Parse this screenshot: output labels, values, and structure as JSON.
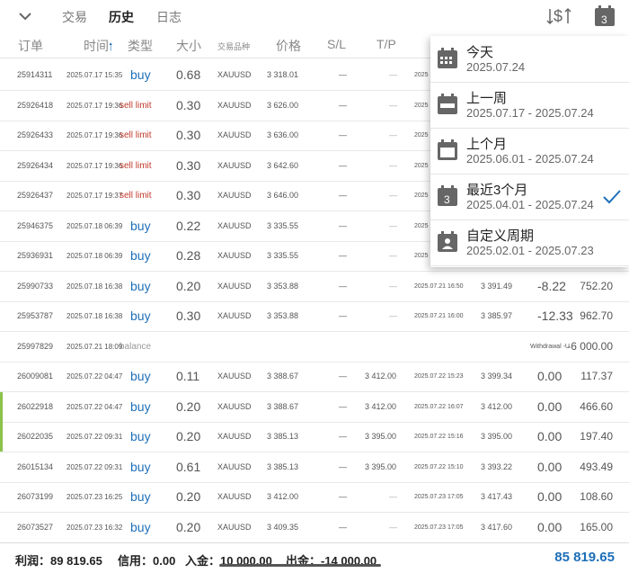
{
  "tabs": [
    "交易",
    "历史",
    "日志"
  ],
  "top_icons": {
    "dollar": "dollar-sort-icon",
    "calendar_day": "3"
  },
  "columns": {
    "ticket": "订单",
    "time": "时间",
    "type": "类型",
    "volume": "大小",
    "symbol": "交易品种",
    "price": "价格",
    "sl": "S/L",
    "tp": "T/P"
  },
  "rows": [
    {
      "id": "25914311",
      "time": "2025.07.17 15:35",
      "type": "buy",
      "volume": "0.68",
      "symbol": "XAUUSD",
      "price": "3 318.01",
      "sl": "—",
      "tp": "—",
      "close_time": "2025",
      "close_price": "",
      "swap": "",
      "profit": "",
      "comment": ""
    },
    {
      "id": "25926418",
      "time": "2025.07.17 19:36",
      "type": "sell limit",
      "volume": "0.30",
      "symbol": "XAUUSD",
      "price": "3 626.00",
      "sl": "—",
      "tp": "—",
      "close_time": "2025",
      "close_price": "",
      "swap": "",
      "profit": "",
      "comment": ""
    },
    {
      "id": "25926433",
      "time": "2025.07.17 19:36",
      "type": "sell limit",
      "volume": "0.30",
      "symbol": "XAUUSD",
      "price": "3 636.00",
      "sl": "—",
      "tp": "—",
      "close_time": "2025",
      "close_price": "",
      "swap": "",
      "profit": "",
      "comment": ""
    },
    {
      "id": "25926434",
      "time": "2025.07.17 19:36",
      "type": "sell limit",
      "volume": "0.30",
      "symbol": "XAUUSD",
      "price": "3 642.60",
      "sl": "—",
      "tp": "—",
      "close_time": "2025",
      "close_price": "",
      "swap": "",
      "profit": "",
      "comment": ""
    },
    {
      "id": "25926437",
      "time": "2025.07.17 19:37",
      "type": "sell limit",
      "volume": "0.30",
      "symbol": "XAUUSD",
      "price": "3 646.00",
      "sl": "—",
      "tp": "—",
      "close_time": "2025",
      "close_price": "",
      "swap": "",
      "profit": "",
      "comment": ""
    },
    {
      "id": "25946375",
      "time": "2025.07.18 06:39",
      "type": "buy",
      "volume": "0.22",
      "symbol": "XAUUSD",
      "price": "3 335.55",
      "sl": "—",
      "tp": "—",
      "close_time": "2025",
      "close_price": "",
      "swap": "",
      "profit": "",
      "comment": ""
    },
    {
      "id": "25936931",
      "time": "2025.07.18 06:39",
      "type": "buy",
      "volume": "0.28",
      "symbol": "XAUUSD",
      "price": "3 335.55",
      "sl": "—",
      "tp": "—",
      "close_time": "2025",
      "close_price": "",
      "swap": "",
      "profit": "",
      "comment": ""
    },
    {
      "id": "25990733",
      "time": "2025.07.18 16:38",
      "type": "buy",
      "volume": "0.20",
      "symbol": "XAUUSD",
      "price": "3 353.88",
      "sl": "—",
      "tp": "—",
      "close_time": "2025.07.21 16:50",
      "close_price": "3 391.49",
      "swap": "-8.22",
      "profit": "752.20",
      "comment": ""
    },
    {
      "id": "25953787",
      "time": "2025.07.18 16:38",
      "type": "buy",
      "volume": "0.30",
      "symbol": "XAUUSD",
      "price": "3 353.88",
      "sl": "—",
      "tp": "—",
      "close_time": "2025.07.21 16:00",
      "close_price": "3 385.97",
      "swap": "-12.33",
      "profit": "962.70",
      "comment": ""
    },
    {
      "id": "25997829",
      "time": "2025.07.21 18:09",
      "type": "balance",
      "volume": "",
      "symbol": "",
      "price": "",
      "sl": "",
      "tp": "",
      "close_time": "",
      "close_price": "",
      "swap": "",
      "profit": "-6 000.00",
      "comment": "Withdrawal -U"
    },
    {
      "id": "26009081",
      "time": "2025.07.22 04:47",
      "type": "buy",
      "volume": "0.11",
      "symbol": "XAUUSD",
      "price": "3 388.67",
      "sl": "—",
      "tp": "3 412.00",
      "close_time": "2025.07.22 15:23",
      "close_price": "3 399.34",
      "swap": "0.00",
      "profit": "117.37",
      "comment": ""
    },
    {
      "id": "26022918",
      "time": "2025.07.22 04:47",
      "type": "buy",
      "volume": "0.20",
      "symbol": "XAUUSD",
      "price": "3 388.67",
      "sl": "—",
      "tp": "3 412.00",
      "close_time": "2025.07.22 16:07",
      "close_price": "3 412.00",
      "swap": "0.00",
      "profit": "466.60",
      "comment": "",
      "marker": true
    },
    {
      "id": "26022035",
      "time": "2025.07.22 09:31",
      "type": "buy",
      "volume": "0.20",
      "symbol": "XAUUSD",
      "price": "3 385.13",
      "sl": "—",
      "tp": "3 395.00",
      "close_time": "2025.07.22 15:16",
      "close_price": "3 395.00",
      "swap": "0.00",
      "profit": "197.40",
      "comment": "",
      "marker": true
    },
    {
      "id": "26015134",
      "time": "2025.07.22 09:31",
      "type": "buy",
      "volume": "0.61",
      "symbol": "XAUUSD",
      "price": "3 385.13",
      "sl": "—",
      "tp": "3 395.00",
      "close_time": "2025.07.22 15:10",
      "close_price": "3 393.22",
      "swap": "0.00",
      "profit": "493.49",
      "comment": ""
    },
    {
      "id": "26073199",
      "time": "2025.07.23 16:25",
      "type": "buy",
      "volume": "0.20",
      "symbol": "XAUUSD",
      "price": "3 412.00",
      "sl": "—",
      "tp": "—",
      "close_time": "2025.07.23 17:05",
      "close_price": "3 417.43",
      "swap": "0.00",
      "profit": "108.60",
      "comment": ""
    },
    {
      "id": "26073527",
      "time": "2025.07.23 16:32",
      "type": "buy",
      "volume": "0.20",
      "symbol": "XAUUSD",
      "price": "3 409.35",
      "sl": "—",
      "tp": "—",
      "close_time": "2025.07.23 17:05",
      "close_price": "3 417.60",
      "swap": "0.00",
      "profit": "165.00",
      "comment": ""
    }
  ],
  "dropdown": [
    {
      "title": "今天",
      "range": "2025.07.24",
      "icon": "calendar-dots-icon",
      "selected": false
    },
    {
      "title": "上一周",
      "range": "2025.07.17 - 2025.07.24",
      "icon": "calendar-week-icon",
      "selected": false
    },
    {
      "title": "上个月",
      "range": "2025.06.01 - 2025.07.24",
      "icon": "calendar-month-icon",
      "selected": false
    },
    {
      "title": "最近3个月",
      "range": "2025.04.01 - 2025.07.24",
      "icon": "calendar-3-icon",
      "selected": true,
      "icon_text": "3"
    },
    {
      "title": "自定义周期",
      "range": "2025.02.01 - 2025.07.23",
      "icon": "calendar-person-icon",
      "selected": false
    }
  ],
  "footer": {
    "profit": "利润：89 819.65",
    "credit": "信用：0.00",
    "deposit": "入金：10 000.00",
    "withdrawal": "出金：-14 000.00",
    "total": "85 819.65"
  },
  "colors": {
    "accent": "#1e6fb8",
    "sell": "#c0392b",
    "marker": "#8bc34a"
  }
}
